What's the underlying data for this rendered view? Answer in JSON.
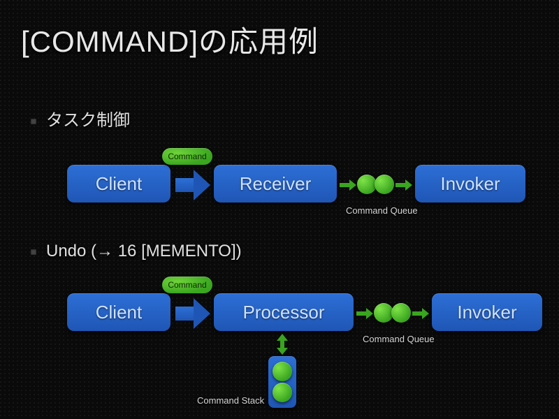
{
  "title": "[COMMAND]の応用例",
  "bullets": {
    "task_control": "タスク制御",
    "undo": "Undo (→ 16 [MEMENTO])"
  },
  "row1": {
    "client": "Client",
    "receiver": "Receiver",
    "invoker": "Invoker",
    "command_pill": "Command",
    "queue_label": "Command Queue"
  },
  "row2": {
    "client": "Client",
    "processor": "Processor",
    "invoker": "Invoker",
    "command_pill": "Command",
    "queue_label": "Command Queue",
    "stack_label": "Command Stack"
  }
}
